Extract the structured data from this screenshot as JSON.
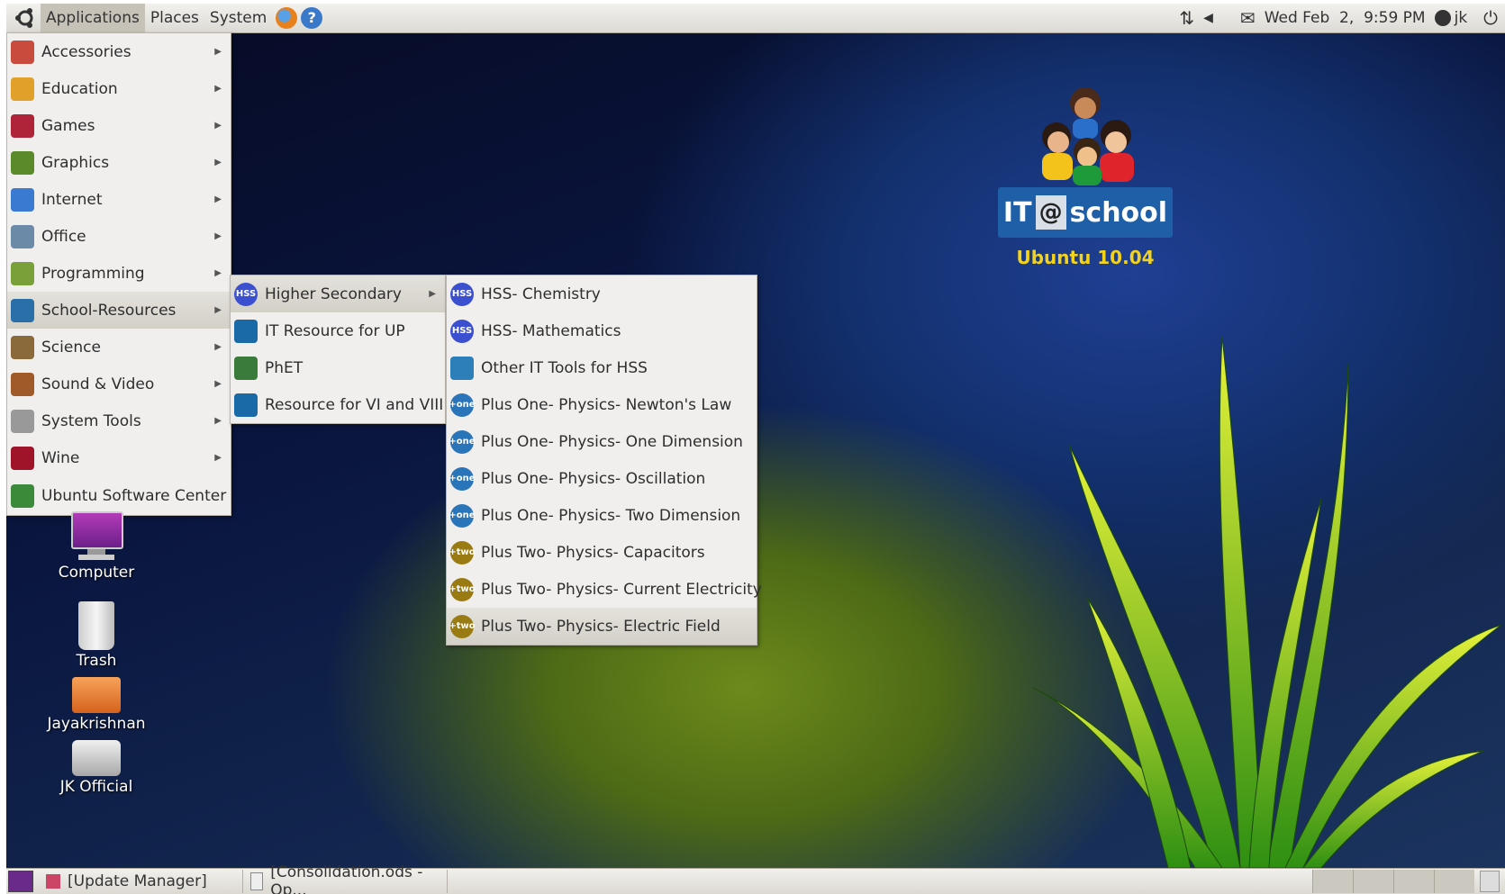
{
  "top_panel": {
    "menus": [
      "Applications",
      "Places",
      "System"
    ],
    "clock": "Wed Feb  2,  9:59 PM",
    "user": "jk"
  },
  "applications_menu": {
    "items": [
      {
        "label": "Accessories",
        "icon": "accessories-icon",
        "submenu": true
      },
      {
        "label": "Education",
        "icon": "education-icon",
        "submenu": true
      },
      {
        "label": "Games",
        "icon": "games-icon",
        "submenu": true
      },
      {
        "label": "Graphics",
        "icon": "graphics-icon",
        "submenu": true
      },
      {
        "label": "Internet",
        "icon": "internet-icon",
        "submenu": true
      },
      {
        "label": "Office",
        "icon": "office-icon",
        "submenu": true
      },
      {
        "label": "Programming",
        "icon": "programming-icon",
        "submenu": true
      },
      {
        "label": "School-Resources",
        "icon": "school-resources-icon",
        "submenu": true
      },
      {
        "label": "Science",
        "icon": "science-icon",
        "submenu": true
      },
      {
        "label": "Sound & Video",
        "icon": "sound-video-icon",
        "submenu": true
      },
      {
        "label": "System Tools",
        "icon": "system-tools-icon",
        "submenu": true
      },
      {
        "label": "Wine",
        "icon": "wine-icon",
        "submenu": true
      },
      {
        "label": "Ubuntu Software Center",
        "icon": "software-center-icon",
        "submenu": false
      }
    ]
  },
  "school_menu": {
    "items": [
      {
        "label": "Higher Secondary",
        "icon": "hss-icon",
        "submenu": true
      },
      {
        "label": "IT Resource for UP",
        "icon": "itschool-icon",
        "submenu": false
      },
      {
        "label": "PhET",
        "icon": "phet-icon",
        "submenu": false
      },
      {
        "label": "Resource for VI and VIII",
        "icon": "itschool-icon",
        "submenu": false
      }
    ]
  },
  "hss_menu": {
    "items": [
      {
        "label": "HSS- Chemistry",
        "badge": "HSS",
        "color": "#3b4fd1"
      },
      {
        "label": "HSS- Mathematics",
        "badge": "HSS",
        "color": "#3b4fd1"
      },
      {
        "label": "Other IT Tools for HSS",
        "badge": "",
        "color": "#2c7fb8"
      },
      {
        "label": "Plus One- Physics- Newton's Law",
        "badge": "+one",
        "color": "#2a74b9"
      },
      {
        "label": "Plus One- Physics- One Dimension",
        "badge": "+one",
        "color": "#2a74b9"
      },
      {
        "label": "Plus One- Physics- Oscillation",
        "badge": "+one",
        "color": "#2a74b9"
      },
      {
        "label": "Plus One- Physics- Two Dimension",
        "badge": "+one",
        "color": "#2a74b9"
      },
      {
        "label": "Plus Two- Physics- Capacitors",
        "badge": "+two",
        "color": "#9a7a12"
      },
      {
        "label": "Plus Two- Physics- Current Electricity",
        "badge": "+two",
        "color": "#9a7a12"
      },
      {
        "label": "Plus Two- Physics- Electric Field",
        "badge": "+two",
        "color": "#9a7a12"
      }
    ]
  },
  "branding": {
    "it": "IT",
    "at": "@",
    "school": "school",
    "version": "Ubuntu 10.04"
  },
  "desktop_icons": [
    "Computer",
    "Trash",
    "Jayakrishnan",
    "JK Official"
  ],
  "taskbar": [
    "[Update Manager]",
    "[Consolidation.ods - Op..."
  ]
}
